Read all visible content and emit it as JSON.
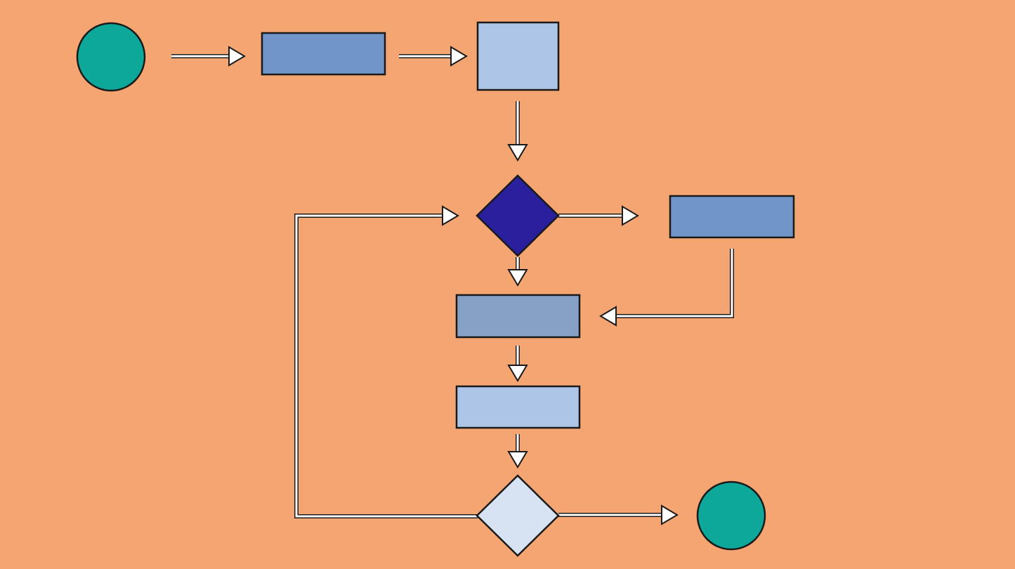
{
  "colors": {
    "background": "#F5A571",
    "start_end": "#0EA89A",
    "process_medium": "#7195C8",
    "process_light": "#ADC5E6",
    "process_muted": "#87A0C6",
    "decision_dark": "#2A1F9C",
    "decision_light": "#D7E3F2",
    "outline": "#1A1A1A",
    "arrow_fill": "#FFFFFF"
  },
  "nodes": [
    {
      "id": "start",
      "shape": "circle",
      "color": "start_end"
    },
    {
      "id": "step-1",
      "shape": "rectangle",
      "color": "process_medium"
    },
    {
      "id": "step-2",
      "shape": "square",
      "color": "process_light"
    },
    {
      "id": "decision-1",
      "shape": "diamond",
      "color": "decision_dark"
    },
    {
      "id": "side-step",
      "shape": "rectangle",
      "color": "process_medium"
    },
    {
      "id": "step-3",
      "shape": "rectangle",
      "color": "process_muted"
    },
    {
      "id": "step-4",
      "shape": "rectangle",
      "color": "process_light"
    },
    {
      "id": "decision-2",
      "shape": "diamond",
      "color": "decision_light"
    },
    {
      "id": "end",
      "shape": "circle",
      "color": "start_end"
    }
  ],
  "edges": [
    {
      "from": "start",
      "to": "step-1"
    },
    {
      "from": "step-1",
      "to": "step-2"
    },
    {
      "from": "step-2",
      "to": "decision-1"
    },
    {
      "from": "decision-1",
      "to": "side-step"
    },
    {
      "from": "decision-1",
      "to": "step-3"
    },
    {
      "from": "side-step",
      "to": "step-3"
    },
    {
      "from": "step-3",
      "to": "step-4"
    },
    {
      "from": "step-4",
      "to": "decision-2"
    },
    {
      "from": "decision-2",
      "to": "end"
    },
    {
      "from": "decision-2",
      "to": "decision-1"
    }
  ]
}
